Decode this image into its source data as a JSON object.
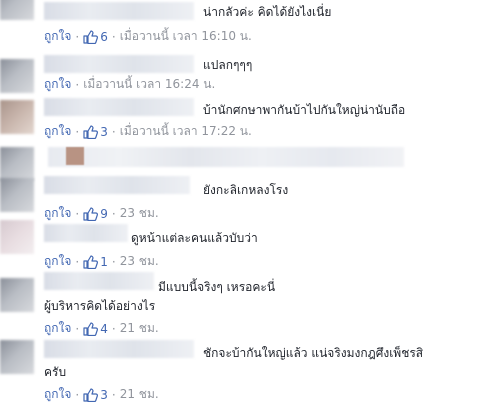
{
  "comments": [
    {
      "text": "น่ากลัวค่ะ คิดได้ยังไงเนี่ย",
      "like_label": "ถูกใจ",
      "likes": "6",
      "time": "เมื่อวานนี้ เวลา 16:10 น."
    },
    {
      "text": "แปลกๆๆๆ",
      "like_label": "ถูกใจ",
      "likes": "",
      "time": "เมื่อวานนี้ เวลา 16:24 น."
    },
    {
      "text": "บ้านักศกษาพากันบ้าไปกันใหญ่น่านับถือ",
      "like_label": "ถูกใจ",
      "likes": "3",
      "time": "เมื่อวานนี้ เวลา 17:22 น."
    },
    {
      "text": "ยังกะลิเกหลงโรง",
      "like_label": "ถูกใจ",
      "likes": "9",
      "time": "23 ชม."
    },
    {
      "text": "ดูหน้าแต่ละคนแล้วบับว่า",
      "like_label": "ถูกใจ",
      "likes": "1",
      "time": "23 ชม."
    },
    {
      "text": "มีแบบนี้จริงๆ เหรอคะนี่",
      "text2": "ผู้บริหารคิดได้อย่างไร",
      "like_label": "ถูกใจ",
      "likes": "4",
      "time": "21 ชม."
    },
    {
      "text": "ชักจะบ้ากันใหญ่แล้ว แน่จริงมงกฎศึงเพ็ชรสิ",
      "text2": "ครับ",
      "like_label": "ถูกใจ",
      "likes": "3",
      "time": "21 ชม."
    }
  ],
  "icons": {
    "like": "thumbs-up-icon"
  },
  "colors": {
    "link": "#4267b2",
    "meta": "#90949c",
    "text": "#1d2129"
  }
}
